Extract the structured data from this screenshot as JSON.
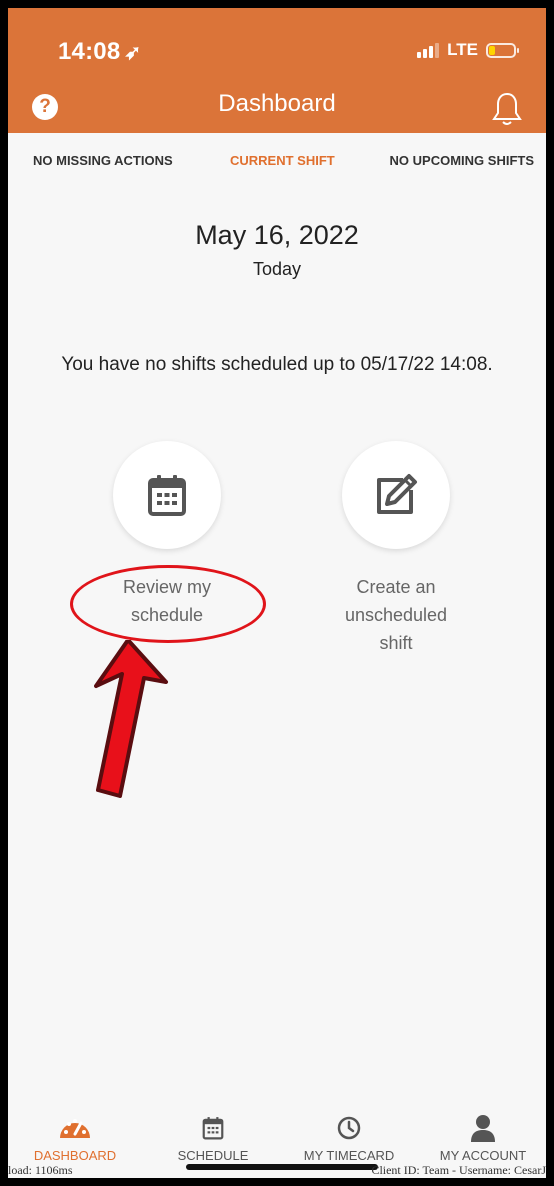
{
  "status_bar": {
    "time": "14:08",
    "network": "LTE"
  },
  "header": {
    "title": "Dashboard",
    "help_icon": "question-circle-icon",
    "bell_icon": "bell-icon",
    "brand_color": "#db7439"
  },
  "tabs": {
    "missing": "NO MISSING ACTIONS",
    "current": "CURRENT SHIFT",
    "upcoming": "NO UPCOMING SHIFTS"
  },
  "main": {
    "date": "May 16, 2022",
    "today": "Today",
    "message": "You have no shifts scheduled up to 05/17/22 14:08.",
    "actions": {
      "review_line1": "Review my",
      "review_line2": "schedule",
      "create_line1": "Create an",
      "create_line2": "unscheduled",
      "create_line3": "shift"
    }
  },
  "bottom_nav": {
    "dashboard": "DASHBOARD",
    "schedule": "SCHEDULE",
    "timecard": "MY TIMECARD",
    "account": "MY ACCOUNT",
    "active_color": "#e0702f"
  },
  "debug": {
    "left": "load: 1106ms",
    "right": "Client ID: Team - Username: CesarJ"
  }
}
